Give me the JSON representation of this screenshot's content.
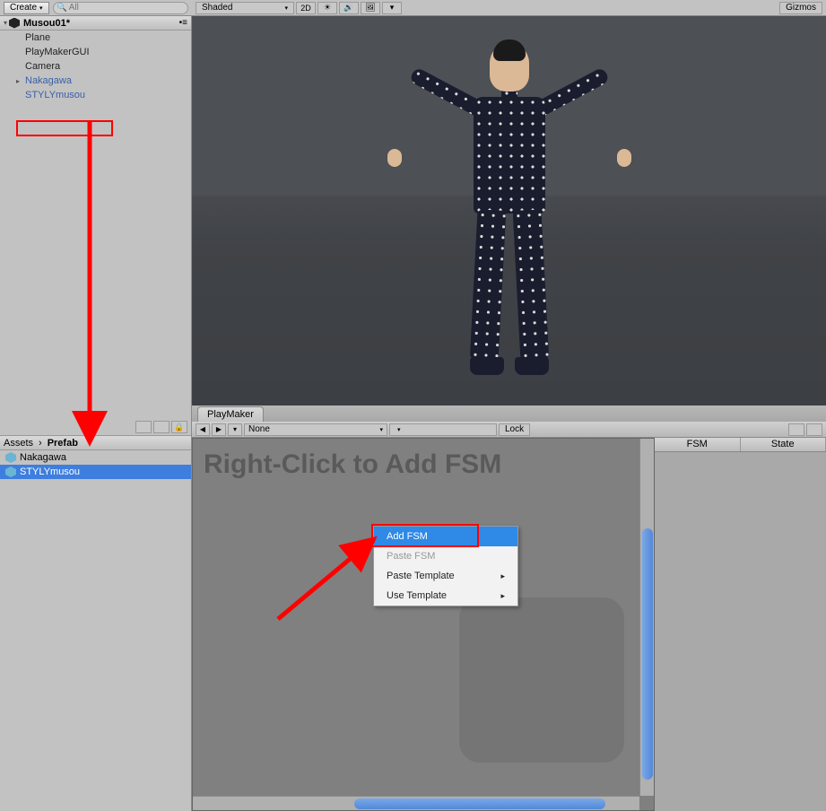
{
  "hierarchy": {
    "createLabel": "Create",
    "searchPlaceholder": "All",
    "sceneName": "Musou01*",
    "items": [
      {
        "label": "Plane",
        "prefab": false
      },
      {
        "label": "PlayMakerGUI",
        "prefab": false
      },
      {
        "label": "Camera",
        "prefab": false
      },
      {
        "label": "Nakagawa",
        "prefab": true,
        "expandable": true
      },
      {
        "label": "STYLYmusou",
        "prefab": true
      }
    ]
  },
  "sceneView": {
    "shadedLabel": "Shaded",
    "btn2D": "2D",
    "gizmosLabel": "Gizmos"
  },
  "project": {
    "breadcrumb": [
      "Assets",
      "Prefab"
    ],
    "items": [
      {
        "label": "Nakagawa"
      },
      {
        "label": "STYLYmusou",
        "selected": true
      }
    ]
  },
  "playmaker": {
    "tabLabel": "PlayMaker",
    "noneLabel": "None",
    "lockLabel": "Lock",
    "hint": "Right-Click to Add FSM",
    "sideTabs": [
      "FSM",
      "State"
    ],
    "contextMenu": [
      {
        "label": "Add FSM",
        "highlight": true
      },
      {
        "label": "Paste FSM",
        "disabled": true
      },
      {
        "label": "Paste Template",
        "sub": true
      },
      {
        "label": "Use Template",
        "sub": true
      }
    ]
  }
}
